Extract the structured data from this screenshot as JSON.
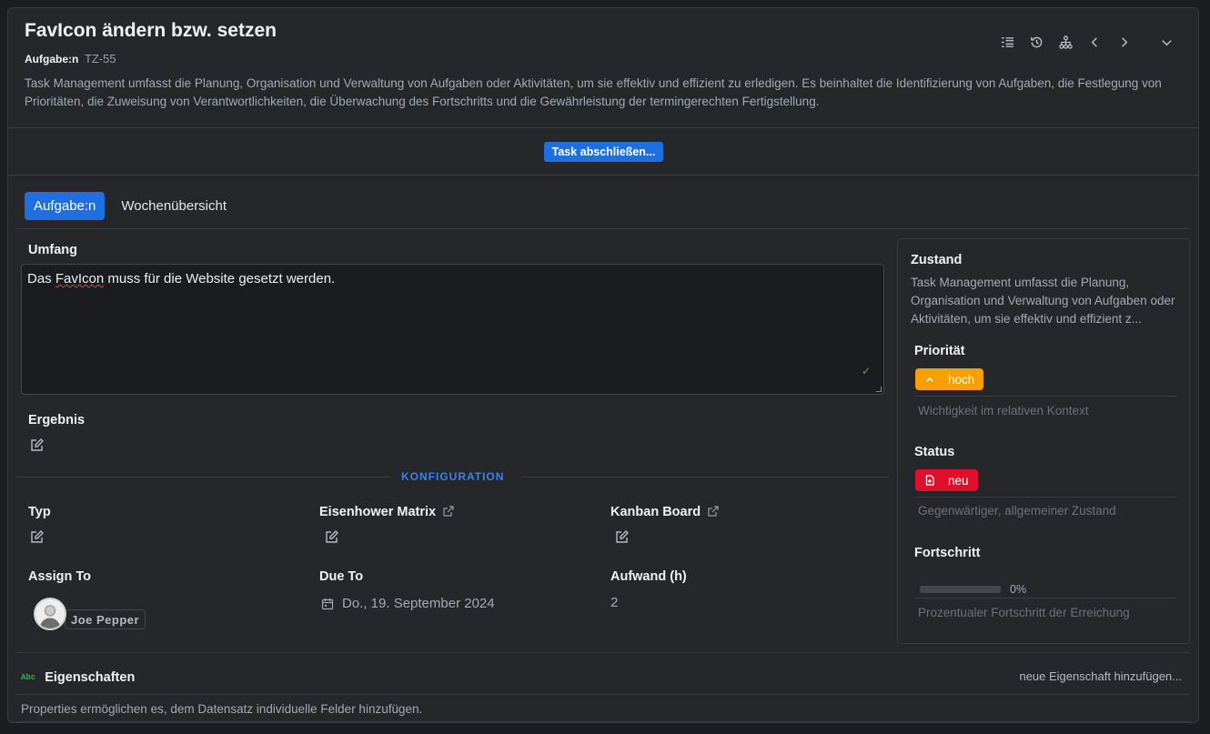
{
  "header": {
    "title": "FavIcon ändern bzw. setzen",
    "type_label": "Aufgabe:n",
    "key": "TZ-55",
    "description": "Task Management umfasst die Planung, Organisation und Verwaltung von Aufgaben oder Aktivitäten, um sie effektiv und effizient zu erledigen. Es beinhaltet die Identifizierung von Aufgaben, die Festlegung von Prioritäten, die Zuweisung von Verantwortlichkeiten, die Überwachung des Fortschritts und die Gewährleistung der termingerechten Fertigstellung."
  },
  "toolbar": {
    "icons": [
      "list-icon",
      "history-icon",
      "hierarchy-icon",
      "chevron-left-icon",
      "chevron-right-icon",
      "chevron-down-icon"
    ]
  },
  "actions": {
    "complete_label": "Task abschließen..."
  },
  "tabs": [
    {
      "label": "Aufgabe:n",
      "active": true
    },
    {
      "label": "Wochenübersicht",
      "active": false
    }
  ],
  "form": {
    "scope_label": "Umfang",
    "scope_value_pre": "Das ",
    "scope_value_flagged": "FavIcon",
    "scope_value_post": " muss für die Website gesetzt werden.",
    "result_label": "Ergebnis",
    "section_label": "KONFIGURATION",
    "type_label": "Typ",
    "eisenhower_label": "Eisenhower Matrix",
    "kanban_label": "Kanban Board",
    "assign_label": "Assign To",
    "assignee_name": "Joe Pepper",
    "due_label": "Due To",
    "due_value": "Do., 19. September 2024",
    "effort_label": "Aufwand (h)",
    "effort_value": "2"
  },
  "panel": {
    "title": "Zustand",
    "description": "Task Management umfasst die Planung, Organisation und Verwaltung von Aufgaben oder Aktivitäten, um sie effektiv und effizient z...",
    "priority_label": "Priorität",
    "priority_value": "hoch",
    "priority_hint": "Wichtigkeit im relativen Kontext",
    "priority_color": "#f5a000",
    "status_label": "Status",
    "status_value": "neu",
    "status_hint": "Gegenwärtiger, allgemeiner Zustand",
    "status_color": "#e0102c",
    "progress_label": "Fortschritt",
    "progress_value": "0%",
    "progress_fraction": 0,
    "progress_hint": "Prozentualer Fortschritt der Erreichung"
  },
  "properties": {
    "icon_text": "Abc",
    "title": "Eigenschaften",
    "add_label": "neue Eigenschaft hinzufügen...",
    "description": "Properties ermöglichen es, dem Datensatz individuelle Felder hinzufügen."
  },
  "colors": {
    "accent": "#1f6fe0",
    "background": "#25272b"
  }
}
